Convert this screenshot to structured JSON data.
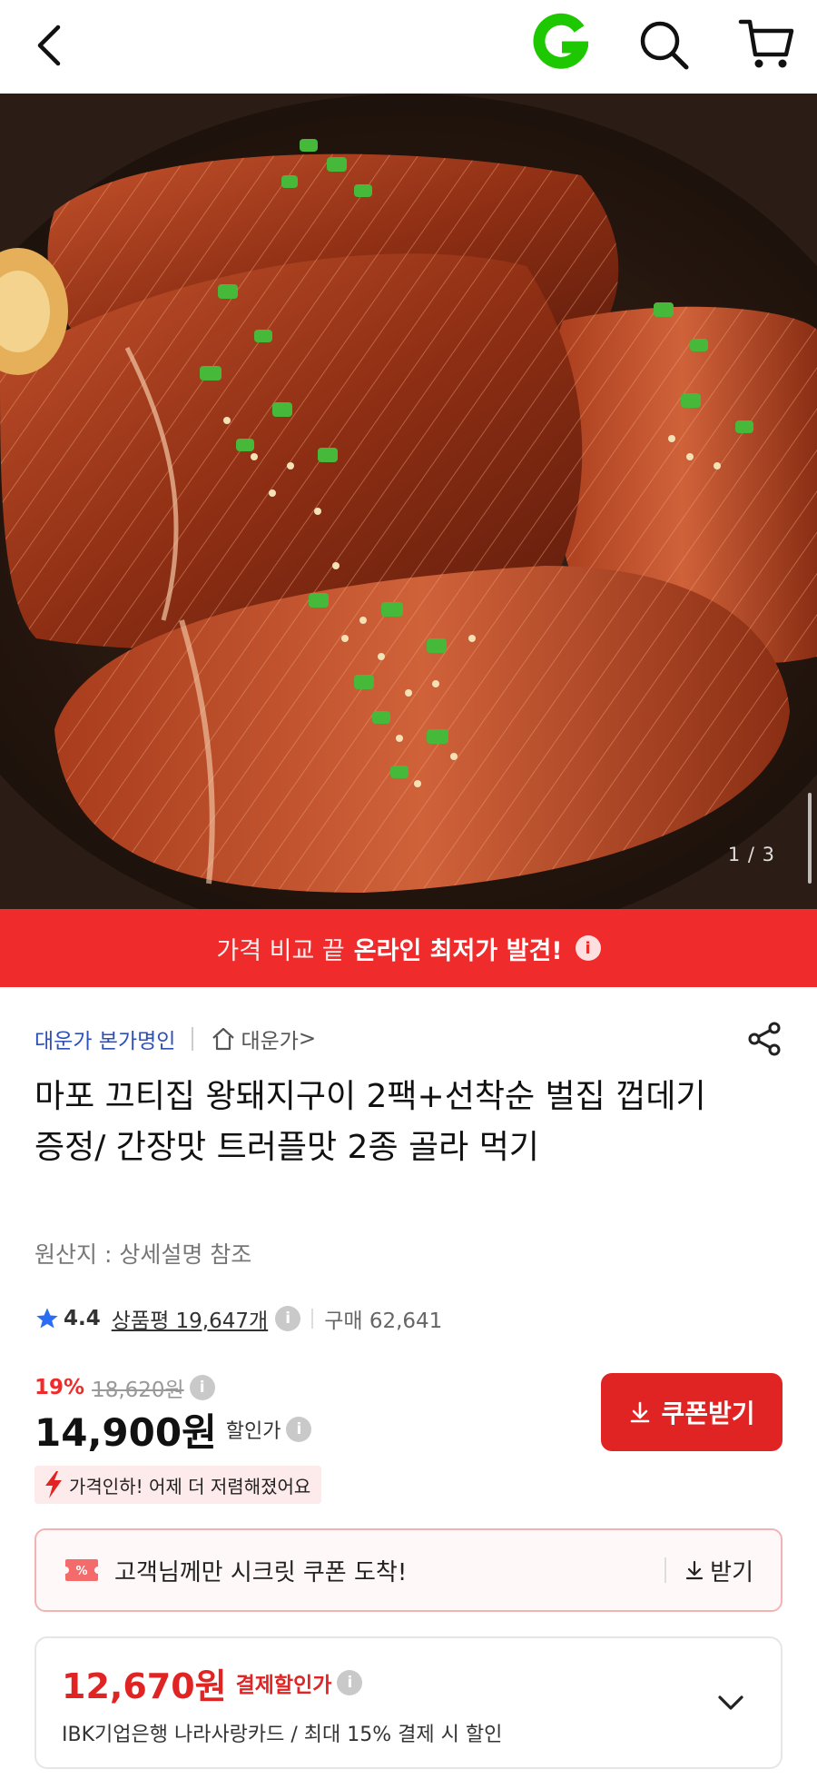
{
  "header": {
    "back_icon": "chevron-left-icon",
    "logo": "G",
    "search_icon": "search-icon",
    "cart_icon": "cart-icon"
  },
  "gallery": {
    "counter": "1 / 3"
  },
  "banner": {
    "text_light": "가격 비교 끝",
    "text_strong": "온라인 최저가 발견!",
    "info_glyph": "i"
  },
  "seller": {
    "name": "대운가 본가명인",
    "store_link": "대운가",
    "chevron": ">"
  },
  "product": {
    "title": "마포 끄티집 왕돼지구이 2팩+선착순 벌집 껍데기 증정/ 간장맛 트러플맛 2종 골라 먹기",
    "origin": "원산지 : 상세설명 참조",
    "rating": "4.4",
    "reviews": "상품평 19,647개",
    "purchases": "구매 62,641"
  },
  "pricing": {
    "discount_pct": "19%",
    "original_price": "18,620원",
    "price": "14,900원",
    "price_label": "할인가",
    "coupon_button": "쿠폰받기",
    "price_drop": "가격인하! 어제 더 저렴해졌어요",
    "info_glyph": "i"
  },
  "secret_coupon": {
    "tag": "%",
    "text": "고객님께만 시크릿 쿠폰 도착!",
    "action": "받기"
  },
  "payment_discount": {
    "price": "12,670원",
    "label": "결제할인가",
    "description": "IBK기업은행 나라사랑카드 / 최대 15% 결제 시 할인"
  },
  "colors": {
    "accent_red": "#e02424",
    "banner_red": "#ef2b2b",
    "seller_blue": "#2c4fb8",
    "logo_green": "#1ec800"
  }
}
